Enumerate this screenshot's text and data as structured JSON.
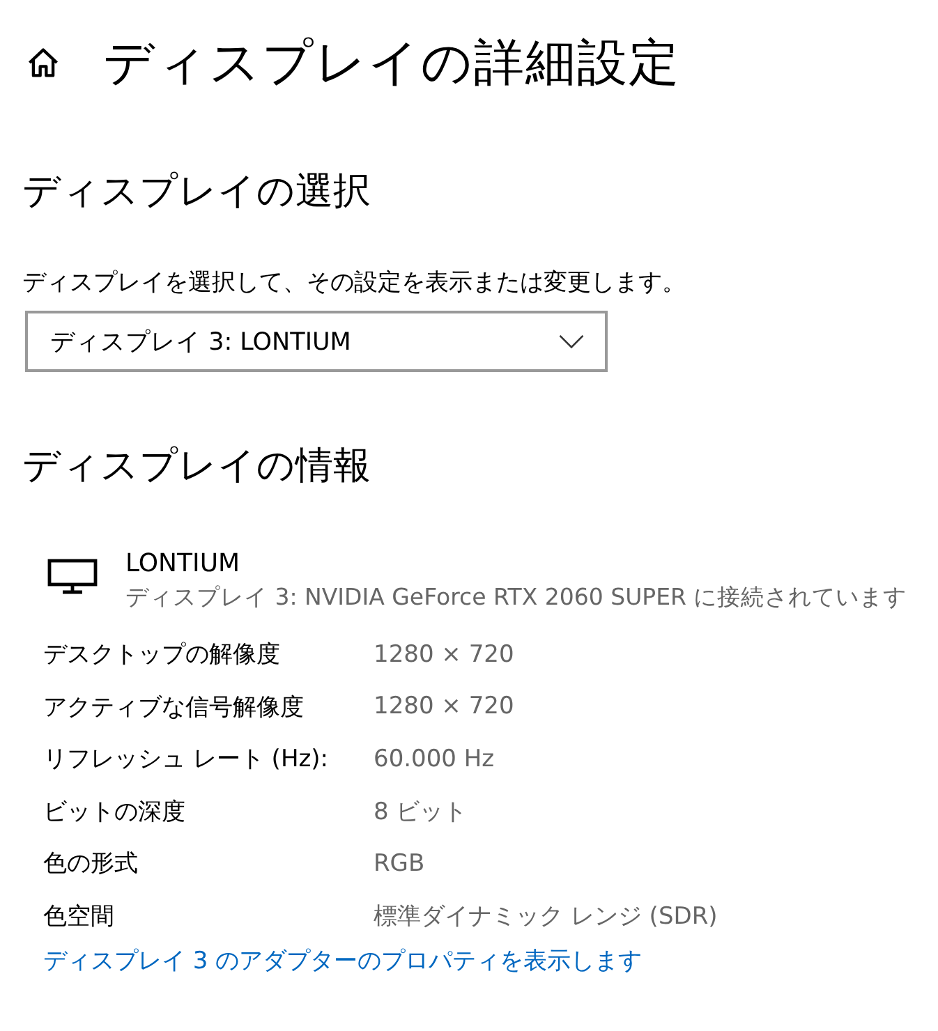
{
  "page": {
    "title": "ディスプレイの詳細設定"
  },
  "display_select": {
    "heading": "ディスプレイの選択",
    "description": "ディスプレイを選択して、その設定を表示または変更します。",
    "dropdown": {
      "value": "ディスプレイ 3: LONTIUM"
    }
  },
  "display_info": {
    "heading": "ディスプレイの情報",
    "monitor_name": "LONTIUM",
    "connection": "ディスプレイ 3: NVIDIA GeForce RTX 2060 SUPER に接続されています",
    "rows": [
      {
        "label": "デスクトップの解像度",
        "value": "1280 × 720"
      },
      {
        "label": "アクティブな信号解像度",
        "value": "1280 × 720"
      },
      {
        "label": "リフレッシュ レート (Hz):",
        "value": "60.000 Hz"
      },
      {
        "label": "ビットの深度",
        "value": "8 ビット"
      },
      {
        "label": "色の形式",
        "value": "RGB"
      },
      {
        "label": "色空間",
        "value": "標準ダイナミック レンジ (SDR)"
      }
    ],
    "link": "ディスプレイ 3 のアダプターのプロパティを表示します"
  }
}
